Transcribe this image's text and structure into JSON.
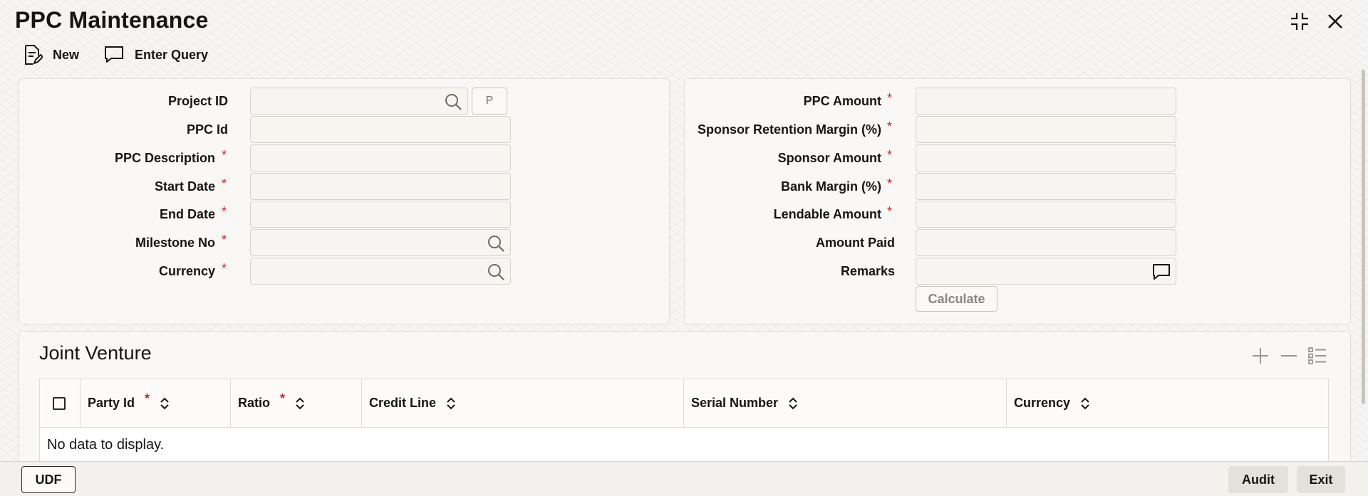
{
  "window": {
    "title": "PPC Maintenance",
    "icons": [
      "minimize-icon",
      "close-icon"
    ]
  },
  "toolbar": {
    "new_label": "New",
    "enter_query_label": "Enter Query"
  },
  "left_form": {
    "project_id": {
      "label": "Project ID",
      "value": "",
      "button": "P"
    },
    "ppc_id": {
      "label": "PPC Id",
      "value": ""
    },
    "ppc_description": {
      "label": "PPC Description",
      "value": "",
      "required": "*"
    },
    "start_date": {
      "label": "Start Date",
      "value": "",
      "required": "*"
    },
    "end_date": {
      "label": "End Date",
      "value": "",
      "required": "*"
    },
    "milestone_no": {
      "label": "Milestone No",
      "value": "",
      "required": "*"
    },
    "currency": {
      "label": "Currency",
      "value": "",
      "required": "*"
    }
  },
  "right_form": {
    "ppc_amount": {
      "label": "PPC Amount",
      "value": "",
      "required": "*"
    },
    "sponsor_retention_margin": {
      "label": "Sponsor Retention Margin (%)",
      "value": "",
      "required": "*"
    },
    "sponsor_amount": {
      "label": "Sponsor Amount",
      "value": "",
      "required": "*"
    },
    "bank_margin": {
      "label": "Bank Margin (%)",
      "value": "",
      "required": "*"
    },
    "lendable_amount": {
      "label": "Lendable Amount",
      "value": "",
      "required": "*"
    },
    "amount_paid": {
      "label": "Amount Paid",
      "value": ""
    },
    "remarks": {
      "label": "Remarks",
      "value": ""
    },
    "calculate_label": "Calculate"
  },
  "joint_venture": {
    "title": "Joint Venture",
    "columns": [
      {
        "label": "Party Id",
        "required": "*"
      },
      {
        "label": "Ratio",
        "required": "*"
      },
      {
        "label": "Credit Line"
      },
      {
        "label": "Serial Number"
      },
      {
        "label": "Currency"
      }
    ],
    "empty_text": "No data to display."
  },
  "footer": {
    "udf_label": "UDF",
    "audit_label": "Audit",
    "exit_label": "Exit"
  }
}
